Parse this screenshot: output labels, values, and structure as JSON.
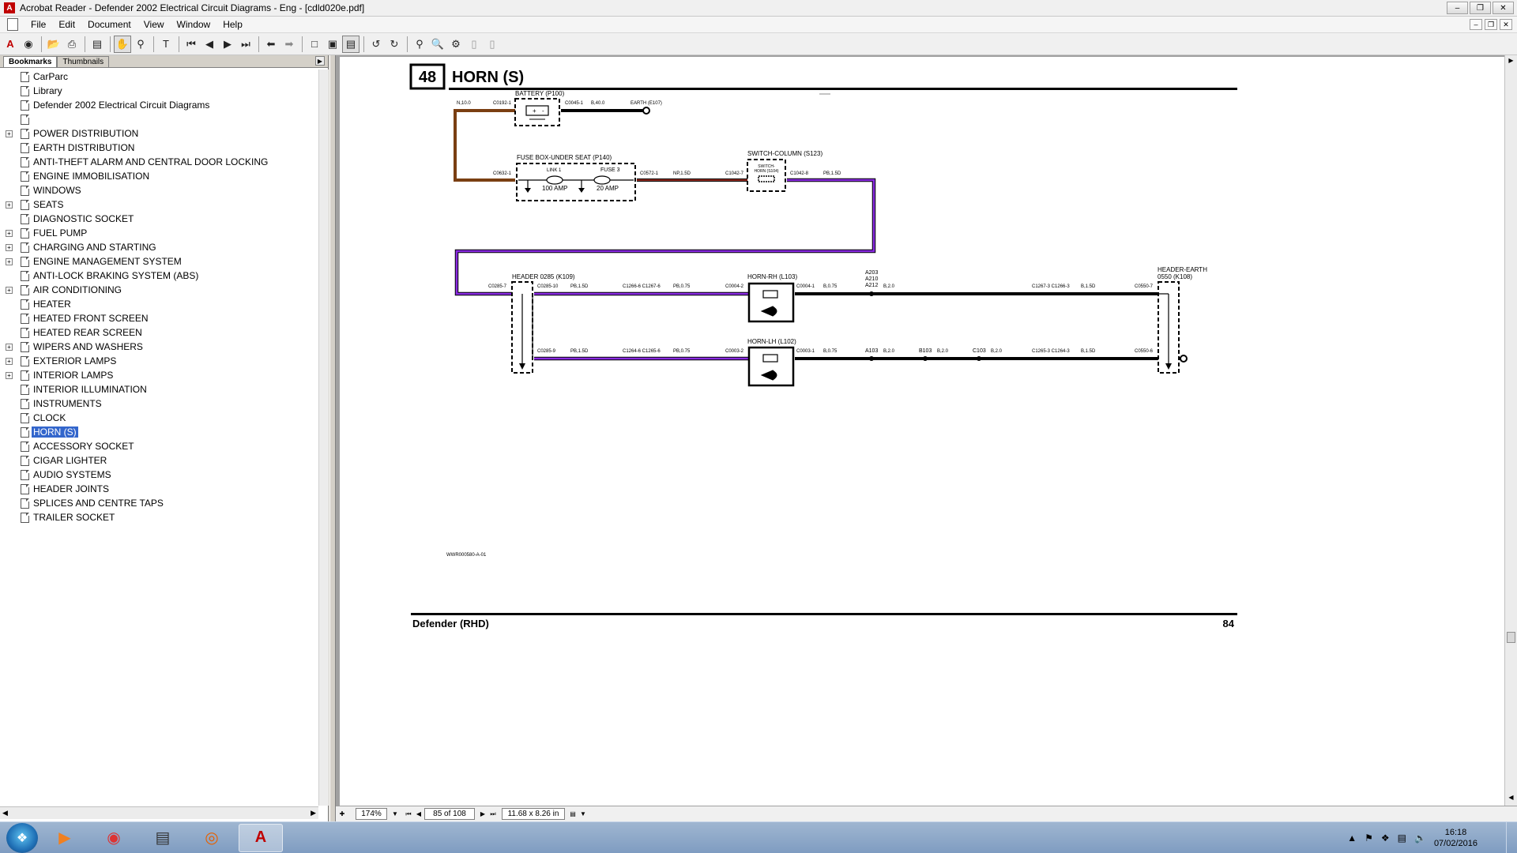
{
  "window": {
    "title": "Acrobat Reader - Defender 2002 Electrical Circuit Diagrams - Eng - [cdld020e.pdf]"
  },
  "menu": [
    "File",
    "Edit",
    "Document",
    "View",
    "Window",
    "Help"
  ],
  "nav": {
    "tabs": [
      "Bookmarks",
      "Thumbnails"
    ],
    "bookmarks": [
      {
        "label": "CarParc",
        "expandable": false
      },
      {
        "label": "Library",
        "expandable": false
      },
      {
        "label": "Defender 2002 Electrical Circuit Diagrams",
        "expandable": false
      },
      {
        "label": "",
        "expandable": false
      },
      {
        "label": "POWER DISTRIBUTION",
        "expandable": true
      },
      {
        "label": "EARTH DISTRIBUTION",
        "expandable": false
      },
      {
        "label": "ANTI-THEFT ALARM AND CENTRAL DOOR LOCKING",
        "expandable": false
      },
      {
        "label": "ENGINE IMMOBILISATION",
        "expandable": false
      },
      {
        "label": "WINDOWS",
        "expandable": false
      },
      {
        "label": "SEATS",
        "expandable": true
      },
      {
        "label": "DIAGNOSTIC SOCKET",
        "expandable": false
      },
      {
        "label": "FUEL PUMP",
        "expandable": true
      },
      {
        "label": "CHARGING AND STARTING",
        "expandable": true
      },
      {
        "label": "ENGINE MANAGEMENT SYSTEM",
        "expandable": true
      },
      {
        "label": "ANTI-LOCK BRAKING SYSTEM (ABS)",
        "expandable": false
      },
      {
        "label": "AIR CONDITIONING",
        "expandable": true
      },
      {
        "label": "HEATER",
        "expandable": false
      },
      {
        "label": "HEATED FRONT SCREEN",
        "expandable": false
      },
      {
        "label": "HEATED REAR SCREEN",
        "expandable": false
      },
      {
        "label": "WIPERS AND WASHERS",
        "expandable": true
      },
      {
        "label": "EXTERIOR LAMPS",
        "expandable": true
      },
      {
        "label": "INTERIOR LAMPS",
        "expandable": true
      },
      {
        "label": "INTERIOR ILLUMINATION",
        "expandable": false
      },
      {
        "label": "INSTRUMENTS",
        "expandable": false
      },
      {
        "label": "CLOCK",
        "expandable": false
      },
      {
        "label": "HORN (S)",
        "expandable": false,
        "selected": true
      },
      {
        "label": "ACCESSORY SOCKET",
        "expandable": false
      },
      {
        "label": "CIGAR LIGHTER",
        "expandable": false
      },
      {
        "label": "AUDIO SYSTEMS",
        "expandable": false
      },
      {
        "label": "HEADER JOINTS",
        "expandable": false
      },
      {
        "label": "SPLICES AND CENTRE TAPS",
        "expandable": false
      },
      {
        "label": "TRAILER SOCKET",
        "expandable": false
      }
    ]
  },
  "page": {
    "number": "48",
    "title": "HORN (S)",
    "footer_model": "Defender (RHD)",
    "footer_page": "84",
    "drawing_ref": "WWR000580-A-01"
  },
  "diagram": {
    "labels": {
      "battery": "BATTERY (P100)",
      "fusebox": "FUSE BOX-UNDER SEAT (P140)",
      "switch": "SWITCH-COLUMN (S123)",
      "switch_inner1": "SWITCH-",
      "switch_inner2": "HORN (S104)",
      "header_k109": "HEADER 0285 (K109)",
      "horn_rh": "HORN-RH (L103)",
      "horn_lh": "HORN-LH (L102)",
      "header_k108_1": "HEADER-EARTH",
      "header_k108_2": "0550 (K108)",
      "link1": "LINK 1",
      "link1_amp": "100 AMP",
      "fuse3": "FUSE 3",
      "fuse3_amp": "20 AMP",
      "earth": "EARTH (E107)",
      "w_n100": "N,10.0",
      "c0192": "C0192-1",
      "c0045": "C0045-1",
      "w_b400": "B,40.0",
      "c0632": "C0632-1",
      "c0572": "C0572-1",
      "w_np15": "NP,1.5D",
      "c1042_7": "C1042-7",
      "c1042_8": "C1042-8",
      "w_pb15_a": "PB,1.5D",
      "c0285_7": "C0285-7",
      "c0285_10": "C0285-10",
      "w_pb15_b": "PB,1.5D",
      "c1266_6": "C1266-6 C1267-6",
      "w_pb075_a": "PB,0.75",
      "c0004_2": "C0004-2",
      "c0004_1": "C0004-1",
      "w_b075_a": "B,0.75",
      "a203": "A203",
      "a210": "A210",
      "a212": "A212",
      "w_b20_a": "B,2.0",
      "c1267_3": "C1267-3 C1266-3",
      "w_b15_a": "B,1.5D",
      "c0550_7": "C0550-7",
      "c0285_9": "C0285-9",
      "w_pb15_c": "PB,1.5D",
      "c1264_6": "C1264-6 C1265-6",
      "w_pb075_b": "PB,0.75",
      "c0003_2": "C0003-2",
      "c0003_1": "C0003-1",
      "w_b075_b": "B,0.75",
      "a103": "A103",
      "w_b20_b": "B,2.0",
      "b103": "B103",
      "w_b20_c": "B,2.0",
      "c103": "C103",
      "w_b20_d": "B,2.0",
      "c1265_3": "C1265-3 C1264-3",
      "w_b15_b": "B,1.5D",
      "c0550_6": "C0550-6"
    },
    "colors": {
      "brown": "#7a3f12",
      "purple": "#8a2be2",
      "black": "#000000",
      "np_red": "#c0392b"
    }
  },
  "status": {
    "zoom": "174%",
    "page_of": "85 of 108",
    "page_size": "11.68 x 8.26 in"
  },
  "taskbar": {
    "time": "16:18",
    "date": "07/02/2016"
  }
}
